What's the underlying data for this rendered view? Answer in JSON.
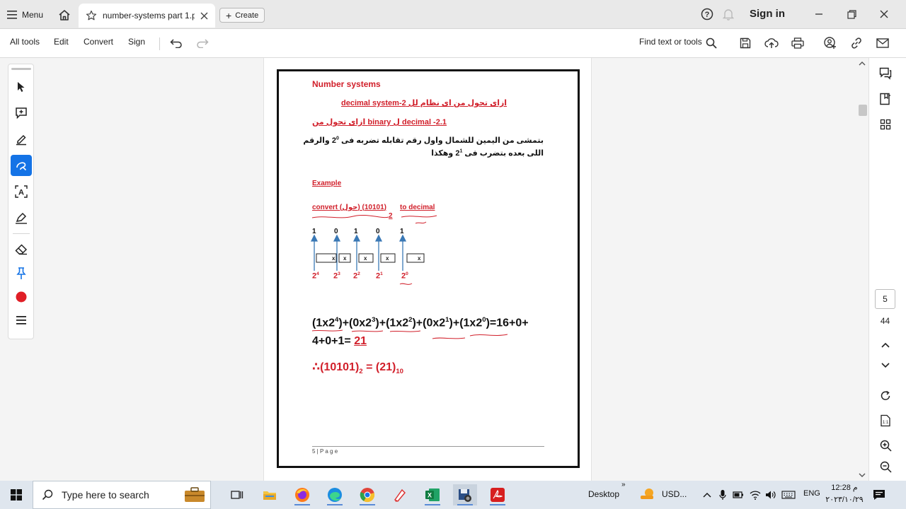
{
  "tabbar": {
    "menu_label": "Menu",
    "doc_tab_title": "number-systems part 1.p...",
    "create_label": "Create",
    "signin_label": "Sign in"
  },
  "toolbar": {
    "all_tools": "All tools",
    "edit": "Edit",
    "convert": "Convert",
    "sign": "Sign",
    "find_text": "Find text or tools"
  },
  "document": {
    "title": "Number systems",
    "subtitle1": "ازاى تحول من اى نظام لل 2-decimal system",
    "subtitle2": "2.1- decimal ل binary ازاى تحول من",
    "arabic_line1_pre": "بتمشى من اليمين للشمال واول رقم تقابله تضربه فى",
    "arabic_line1_base": "2",
    "arabic_line1_exp": "0",
    "arabic_line1_post": "والرقم",
    "arabic_line2_pre": "اللى بعده بتضرب فى",
    "arabic_line2_base": "2",
    "arabic_line2_exp": "1",
    "arabic_line2_post": "وهكذا",
    "example_label": "Example",
    "convert_text": "convert (حول) (10101)",
    "convert_base": "2",
    "convert_to": "to decimal",
    "binary_digits": [
      "1",
      "0",
      "1",
      "0",
      "1"
    ],
    "powers": [
      {
        "base": "2",
        "exp": "4"
      },
      {
        "base": "2",
        "exp": "3"
      },
      {
        "base": "2",
        "exp": "2"
      },
      {
        "base": "2",
        "exp": "1"
      },
      {
        "base": "2",
        "exp": "0"
      }
    ],
    "box_mark": "x",
    "eq_terms": [
      {
        "pre": "(1x2",
        "exp": "4",
        "post": ")+"
      },
      {
        "pre": "(0x2",
        "exp": "3",
        "post": ")+"
      },
      {
        "pre": "(1x2",
        "exp": "2",
        "post": ")+"
      },
      {
        "pre": "(0x2",
        "exp": "1",
        "post": ")+"
      },
      {
        "pre": "(1x2",
        "exp": "0",
        "post": ")=16+0+"
      }
    ],
    "eq_line2": "4+0+1=",
    "eq_result": "21",
    "therefore": "∴(10101)",
    "therefore_base_from": "2",
    "therefore_mid": " = (21)",
    "therefore_base_to": "10",
    "footer": "5 | P a g e"
  },
  "sidebar": {
    "current_page": "5",
    "total_pages": "44"
  },
  "taskbar": {
    "search_placeholder": "Type here to search",
    "desktop_label": "Desktop",
    "weather_label": "USD...",
    "lang": "ENG",
    "time": "12:28 م",
    "date": "٢٠٢٣/١٠/٢٩"
  },
  "colors": {
    "accent_blue": "#1473e6",
    "doc_red": "#d11f2a",
    "arrow_blue": "#3a78b5"
  }
}
